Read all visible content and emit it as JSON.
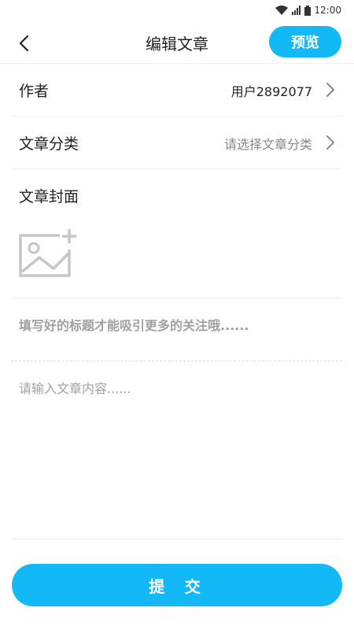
{
  "status_bar": {
    "time": "12:00",
    "icons": [
      "wifi-icon",
      "signal-icon",
      "battery-icon"
    ]
  },
  "header": {
    "title": "编辑文章",
    "back_icon": "chevron-left-icon",
    "preview_label": "预览"
  },
  "form": {
    "author": {
      "label": "作者",
      "value": "用户2892077"
    },
    "category": {
      "label": "文章分类",
      "placeholder": "请选择文章分类"
    },
    "cover": {
      "label": "文章封面",
      "icon": "image-add-icon"
    },
    "title_placeholder": "填写好的标题才能吸引更多的关注哦......",
    "content_placeholder": "请输入文章内容......"
  },
  "submit_label": "提 交",
  "colors": {
    "accent": "#12b9f6",
    "divider": "#eeeeee",
    "muted_text": "#888888"
  }
}
